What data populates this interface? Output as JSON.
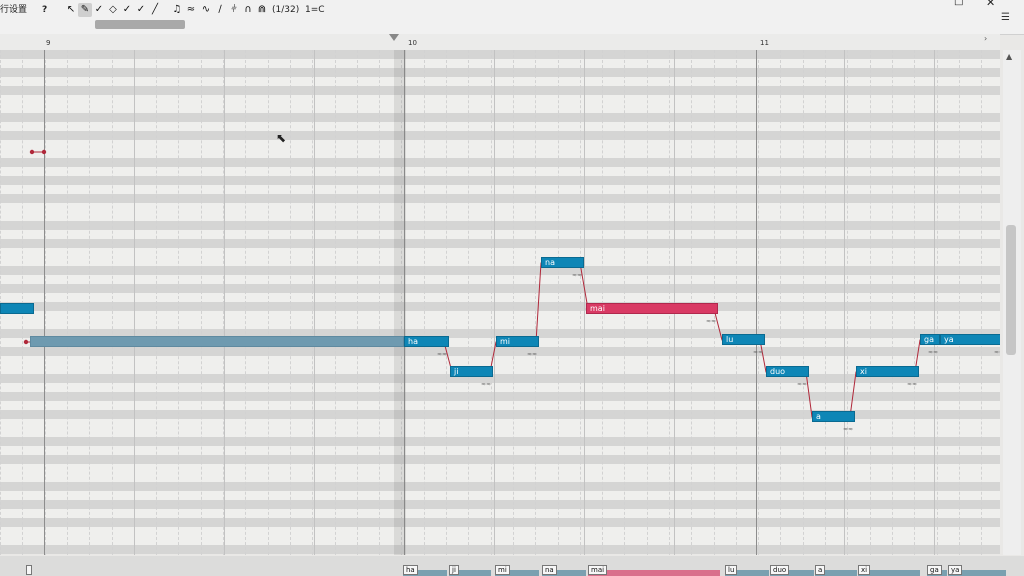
{
  "toolbar": {
    "menu_label": "行设置",
    "help_label": "?",
    "tools": [
      {
        "icon": "pointer-icon",
        "glyph": "↖",
        "active": false
      },
      {
        "icon": "pencil-icon",
        "glyph": "✎",
        "active": true
      },
      {
        "icon": "pitch-pen-icon",
        "glyph": "✓",
        "active": false
      },
      {
        "icon": "eraser-icon",
        "glyph": "◇",
        "active": false
      },
      {
        "icon": "pitch-draw-icon",
        "glyph": "✓",
        "active": false
      },
      {
        "icon": "vibrato-pen-icon",
        "glyph": "✓",
        "active": false
      },
      {
        "icon": "knife-icon",
        "glyph": "╱",
        "active": false
      },
      {
        "icon": "note-icon",
        "glyph": "♫",
        "active": false
      },
      {
        "icon": "vibrato-icon",
        "glyph": "≈",
        "active": false
      },
      {
        "icon": "pitch-curve-icon",
        "glyph": "∿",
        "active": false
      },
      {
        "icon": "line-icon",
        "glyph": "∕",
        "active": false
      },
      {
        "icon": "split-icon",
        "glyph": "⫩",
        "active": false
      },
      {
        "icon": "arc-icon",
        "glyph": "∩",
        "active": false
      },
      {
        "icon": "snap-icon",
        "glyph": "⋒",
        "active": false
      }
    ],
    "quantize": "(1/32)",
    "key": "1=C"
  },
  "ruler": {
    "bars": [
      "9",
      "10",
      "11"
    ]
  },
  "notes": [
    {
      "lyric": "ha",
      "style": "normal"
    },
    {
      "lyric": "ji",
      "style": "normal"
    },
    {
      "lyric": "mi",
      "style": "normal"
    },
    {
      "lyric": "na",
      "style": "normal"
    },
    {
      "lyric": "mai",
      "style": "selected"
    },
    {
      "lyric": "lu",
      "style": "normal"
    },
    {
      "lyric": "duo",
      "style": "normal"
    },
    {
      "lyric": "a",
      "style": "normal"
    },
    {
      "lyric": "xi",
      "style": "normal"
    },
    {
      "lyric": "ga",
      "style": "normal"
    },
    {
      "lyric": "ya",
      "style": "normal"
    }
  ],
  "lyrics_track": [
    "ha",
    "ji",
    "mi",
    "na",
    "mai",
    "lu",
    "duo",
    "a",
    "xi",
    "ga",
    "ya"
  ],
  "colors": {
    "note": "#0e86b6",
    "selected_note": "#d93a64",
    "pitch_line": "#b0283a"
  }
}
